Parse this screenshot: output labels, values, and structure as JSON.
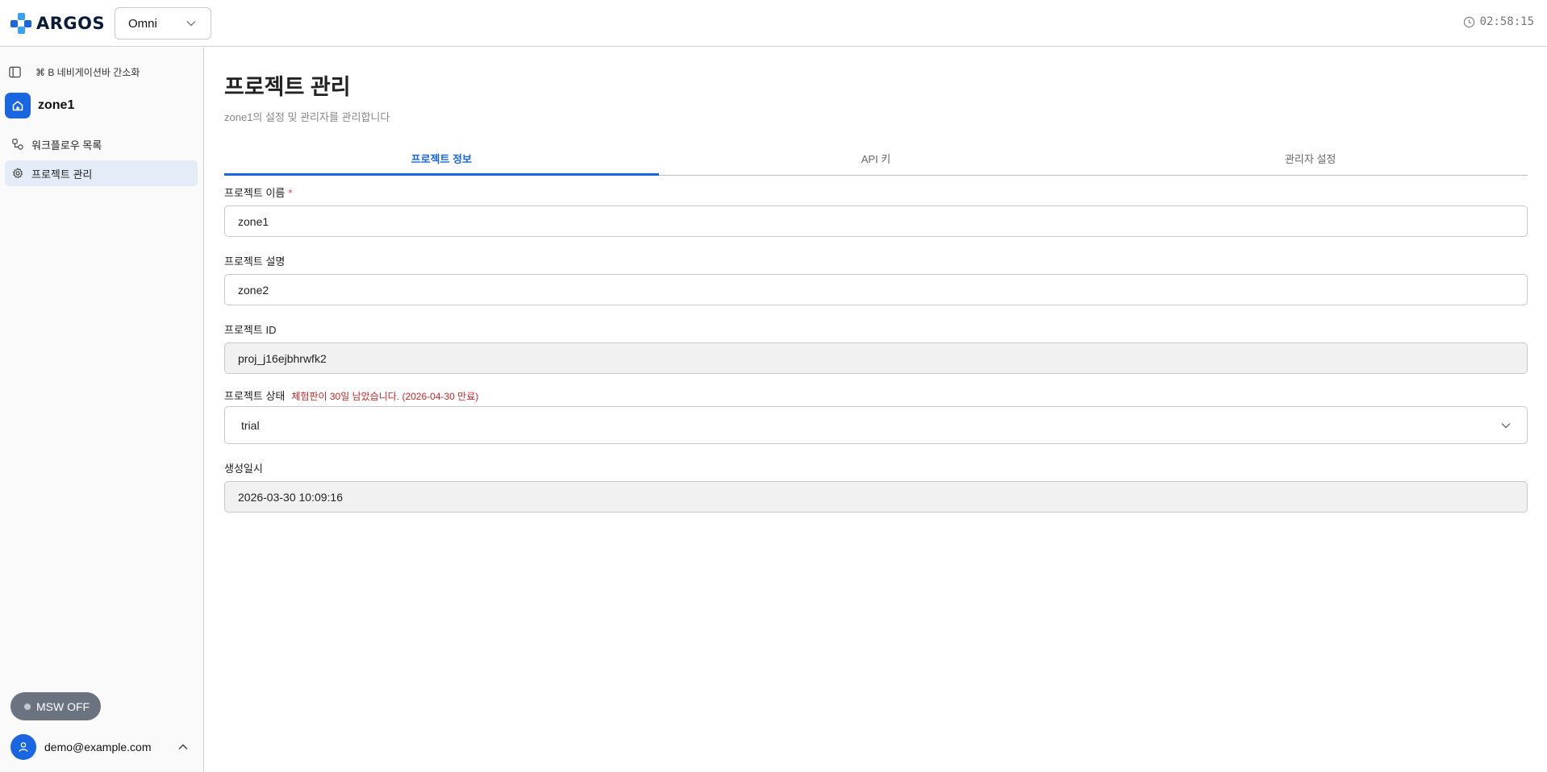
{
  "app": {
    "logo_text": "ARGOS",
    "workspace_selected": "Omni",
    "clock": "02:58:15"
  },
  "sidebar": {
    "shortcut_hint": "⌘ B 네비게이션바 간소화",
    "project_name": "zone1",
    "items": [
      {
        "label": "워크플로우 목록",
        "icon": "workflow-icon"
      },
      {
        "label": "프로젝트 관리",
        "icon": "gear-icon",
        "active": true
      }
    ],
    "msw_label": "MSW OFF",
    "user_email": "demo@example.com"
  },
  "main": {
    "title": "프로젝트 관리",
    "subtitle": "zone1의 설정 및 관리자를 관리합니다",
    "tabs": [
      {
        "label": "프로젝트 정보",
        "active": true
      },
      {
        "label": "API 키"
      },
      {
        "label": "관리자 설정"
      }
    ],
    "fields": {
      "name": {
        "label": "프로젝트 이름",
        "required_mark": "*",
        "value": "zone1"
      },
      "description": {
        "label": "프로젝트 설명",
        "value": "zone2"
      },
      "id": {
        "label": "프로젝트 ID",
        "value": "proj_j16ejbhrwfk2"
      },
      "status": {
        "label": "프로젝트 상태",
        "warning": "체험판이 30일 남았습니다. (2026-04-30 만료)",
        "value": "trial"
      },
      "created": {
        "label": "생성일시",
        "value": "2026-03-30 10:09:16"
      }
    }
  },
  "colors": {
    "accent": "#1a66e0",
    "warning": "#c62828",
    "required": "#e53935"
  }
}
